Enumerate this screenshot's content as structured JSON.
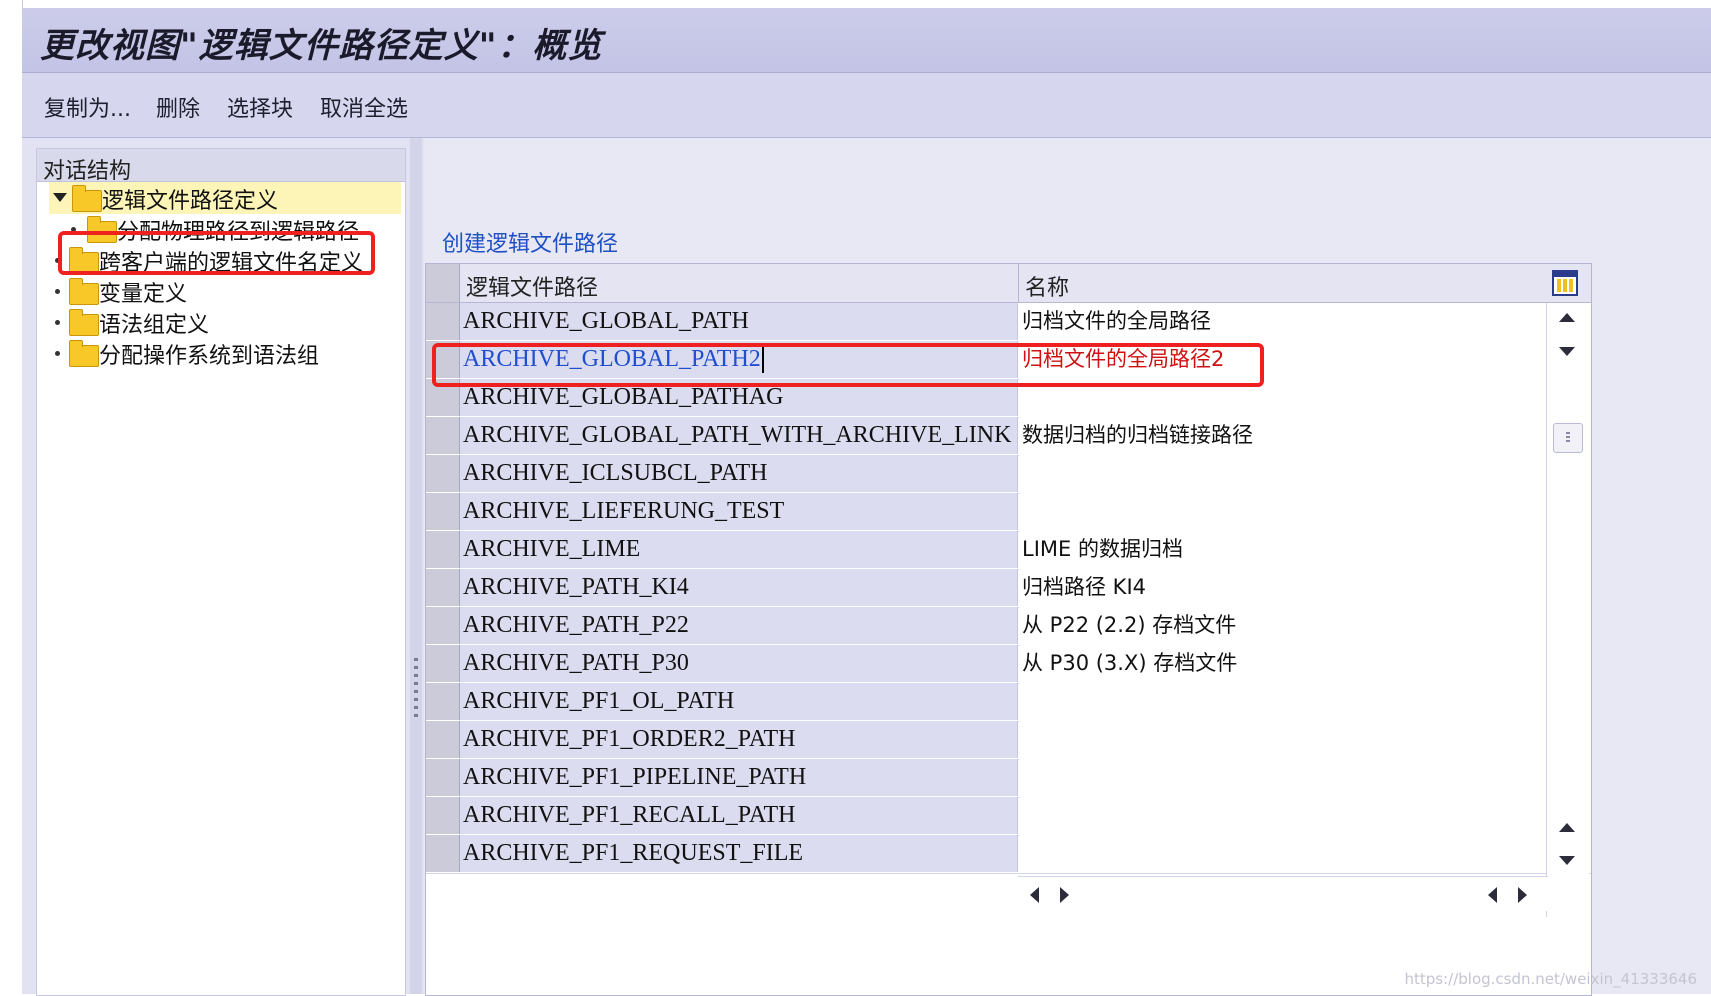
{
  "window": {
    "title": "更改视图\"逻辑文件路径定义\"：概览"
  },
  "toolbar": {
    "copy_as": "复制为...",
    "delete": "删除",
    "select_block": "选择块",
    "deselect_all": "取消全选"
  },
  "dialog_structure": {
    "header": "对话结构",
    "items": [
      {
        "label": "逻辑文件路径定义"
      },
      {
        "label": "分配物理路径到逻辑路径"
      },
      {
        "label": "跨客户端的逻辑文件名定义"
      },
      {
        "label": "变量定义"
      },
      {
        "label": "语法组定义"
      },
      {
        "label": "分配操作系统到语法组"
      }
    ]
  },
  "table": {
    "title": "创建逻辑文件路径",
    "columns": {
      "path": "逻辑文件路径",
      "name": "名称"
    },
    "rows": [
      {
        "path": "ARCHIVE_GLOBAL_PATH",
        "name": "归档文件的全局路径"
      },
      {
        "path": "ARCHIVE_GLOBAL_PATH2",
        "name": "归档文件的全局路径2"
      },
      {
        "path": "ARCHIVE_GLOBAL_PATHAG",
        "name": ""
      },
      {
        "path": "ARCHIVE_GLOBAL_PATH_WITH_ARCHIVE_LINK",
        "name": "数据归档的归档链接路径"
      },
      {
        "path": "ARCHIVE_ICLSUBCL_PATH",
        "name": ""
      },
      {
        "path": "ARCHIVE_LIEFERUNG_TEST",
        "name": ""
      },
      {
        "path": "ARCHIVE_LIME",
        "name": "LIME 的数据归档"
      },
      {
        "path": "ARCHIVE_PATH_KI4",
        "name": "归档路径 KI4"
      },
      {
        "path": "ARCHIVE_PATH_P22",
        "name": "从 P22 (2.2) 存档文件"
      },
      {
        "path": "ARCHIVE_PATH_P30",
        "name": "从 P30 (3.X) 存档文件"
      },
      {
        "path": "ARCHIVE_PF1_OL_PATH",
        "name": ""
      },
      {
        "path": "ARCHIVE_PF1_ORDER2_PATH",
        "name": ""
      },
      {
        "path": "ARCHIVE_PF1_PIPELINE_PATH",
        "name": ""
      },
      {
        "path": "ARCHIVE_PF1_RECALL_PATH",
        "name": ""
      },
      {
        "path": "ARCHIVE_PF1_REQUEST_FILE",
        "name": ""
      }
    ]
  },
  "watermark": "https://blog.csdn.net/weixin_41333646",
  "colors": {
    "highlight_box": "#ee2020",
    "link_text": "#1f50c4",
    "edited_name": "#d01010"
  }
}
